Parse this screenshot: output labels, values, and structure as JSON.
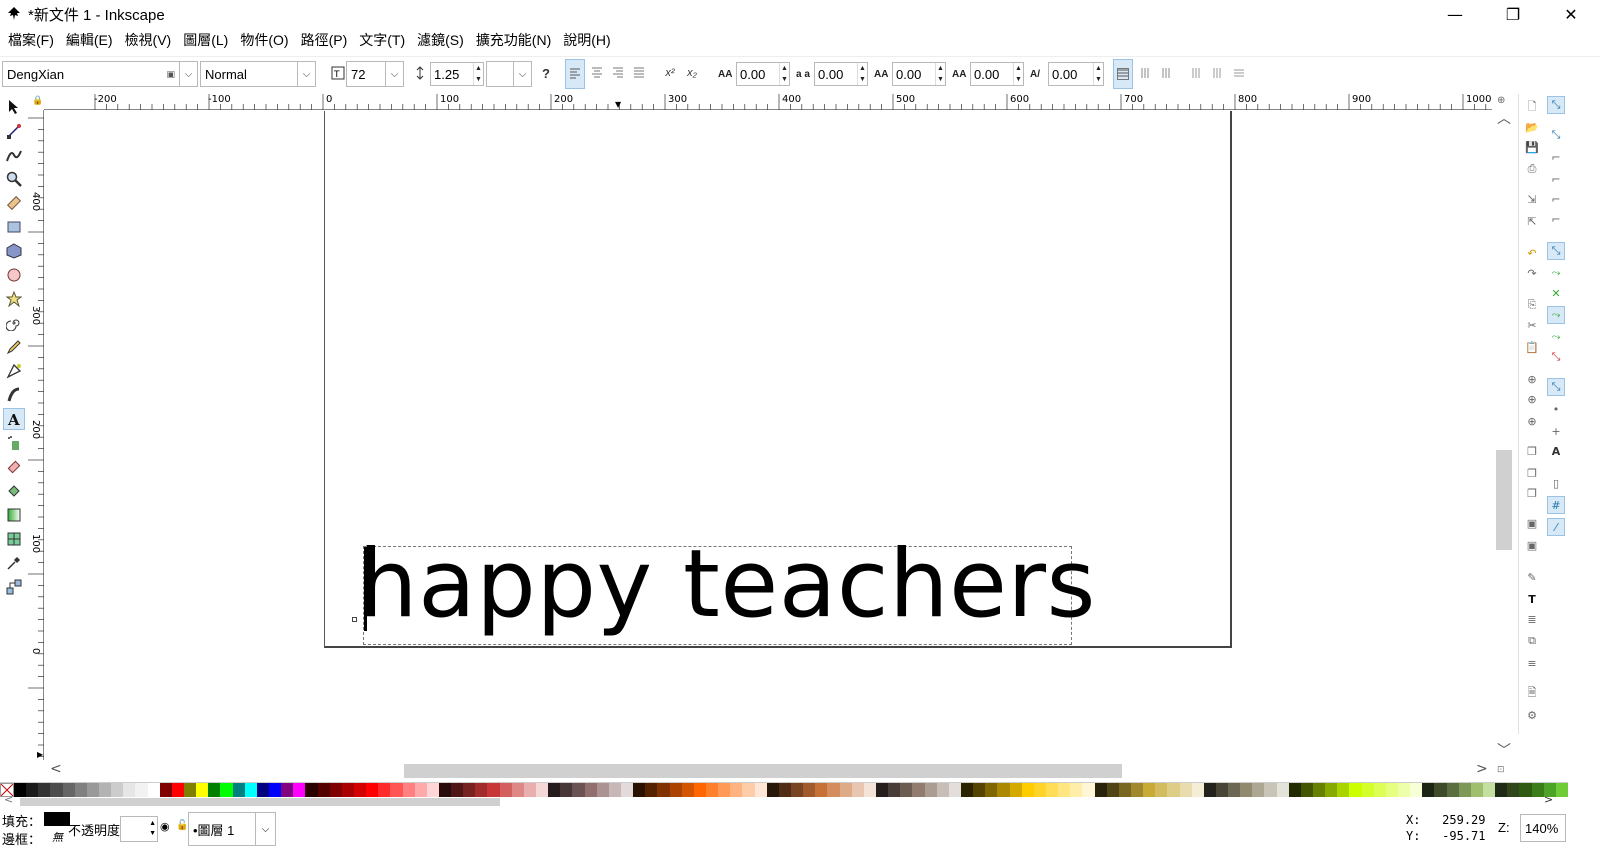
{
  "window": {
    "title": "*新文件 1 - Inkscape",
    "minimize": "—",
    "maximize": "❐",
    "close": "✕"
  },
  "menu": [
    "檔案(F)",
    "編輯(E)",
    "檢視(V)",
    "圖層(L)",
    "物件(O)",
    "路徑(P)",
    "文字(T)",
    "濾鏡(S)",
    "擴充功能(N)",
    "說明(H)"
  ],
  "textbar": {
    "font_family": "DengXian",
    "font_style": "Normal",
    "font_size": "72",
    "line_height": "1.25",
    "unit": "",
    "letter_spacing": "0.00",
    "word_spacing": "0.00",
    "kerning_h": "0.00",
    "kerning_v": "0.00",
    "rotation": "0.00",
    "help": "?"
  },
  "ruler": {
    "h_labels": [
      "-200",
      "-100",
      "0",
      "100",
      "200",
      "300",
      "400",
      "500",
      "600",
      "700",
      "800",
      "900",
      "1000"
    ],
    "v_labels": [
      "400",
      "300",
      "200",
      "100",
      "0"
    ]
  },
  "canvas": {
    "text": "happy teachers"
  },
  "status": {
    "fill_label": "填充：",
    "stroke_label": "邊框：",
    "stroke_value": "無",
    "opacity_label": "不透明度：",
    "layer": "•圖層 1",
    "x_label": "X:",
    "x_value": "259.29",
    "y_label": "Y:",
    "y_value": "-95.71",
    "zoom_label": "Z:",
    "zoom_value": "140%"
  },
  "palette": [
    "#000000",
    "#1a1a1a",
    "#333333",
    "#4d4d4d",
    "#666666",
    "#808080",
    "#999999",
    "#b3b3b3",
    "#cccccc",
    "#e6e6e6",
    "#f2f2f2",
    "#ffffff",
    "#800000",
    "#ff0000",
    "#808000",
    "#ffff00",
    "#008000",
    "#00ff00",
    "#008080",
    "#00ffff",
    "#000080",
    "#0000ff",
    "#800080",
    "#ff00ff",
    "#2b0000",
    "#550000",
    "#800000",
    "#aa0000",
    "#d40000",
    "#ff0000",
    "#ff2a2a",
    "#ff5555",
    "#ff8080",
    "#ffaaaa",
    "#ffd5d5",
    "#280b0b",
    "#501616",
    "#782121",
    "#a02c2c",
    "#c83737",
    "#d35f5f",
    "#de8787",
    "#e9afaf",
    "#f4d7d7",
    "#241c1c",
    "#483737",
    "#6c5353",
    "#916f6f",
    "#ac9393",
    "#c8b7b7",
    "#e3dbdb",
    "#2b1100",
    "#552200",
    "#803300",
    "#aa4400",
    "#d45500",
    "#ff6600",
    "#ff7f2a",
    "#ff9955",
    "#ffb380",
    "#ffccaa",
    "#ffe6d5",
    "#28170b",
    "#502d16",
    "#784421",
    "#a05a2c",
    "#c87137",
    "#d38d5f",
    "#deaa87",
    "#e9c6af",
    "#f4e3d7",
    "#241f1c",
    "#483e37",
    "#6c5d53",
    "#917c6f",
    "#ac9d93",
    "#c8beb7",
    "#e3dedb",
    "#2b2200",
    "#554400",
    "#806600",
    "#aa8800",
    "#d4aa00",
    "#ffcc00",
    "#ffd42a",
    "#ffdd55",
    "#ffe680",
    "#ffeeaa",
    "#fff6d5",
    "#28220b",
    "#504416",
    "#786721",
    "#a0892c",
    "#c8ab37",
    "#d3bc5f",
    "#decd87",
    "#e9ddaf",
    "#f4eed7",
    "#24221c",
    "#484537",
    "#6c6753",
    "#918a6f",
    "#aca793",
    "#c8c4b7",
    "#e3e2db",
    "#222b00",
    "#445500",
    "#668000",
    "#88aa00",
    "#aad400",
    "#ccff00",
    "#d4ff2a",
    "#ddff55",
    "#e5ff80",
    "#eeffaa",
    "#f6ffd5",
    "#1c2414",
    "#3e4a2a",
    "#5a6e40",
    "#7d9857",
    "#9fbf6f",
    "#c4dfa0",
    "#1f2b17",
    "#30461a",
    "#2f5a12",
    "#3a7d19",
    "#4da327",
    "#6fcc36"
  ]
}
